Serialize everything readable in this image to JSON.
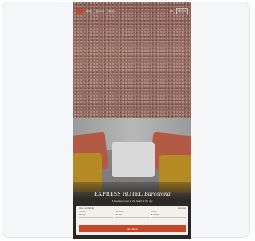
{
  "nav": {
    "links": [
      "Hotel",
      "Rooms",
      "Offers"
    ],
    "right": [
      "EN",
      "BOOK"
    ]
  },
  "hero": {
    "title_main": "EXPRESS HOTEL",
    "title_city": "Barcelona",
    "tagline": "A boutique hotel in the heart of the city"
  },
  "booking": {
    "header_left": "Check availability",
    "header_right": "Best rate",
    "fields": [
      {
        "label": "Check-in",
        "value": "14 Jun"
      },
      {
        "label": "Check-out",
        "value": "15 Jun"
      },
      {
        "label": "Guests",
        "value": "2 Adults"
      }
    ],
    "cta_label": "SEARCH"
  }
}
